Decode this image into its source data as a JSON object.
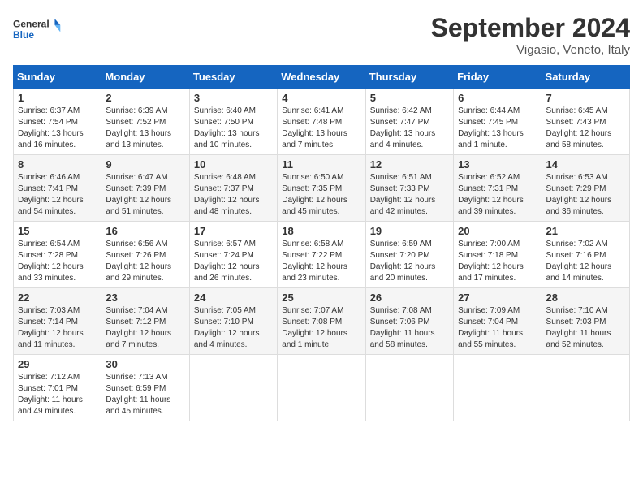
{
  "header": {
    "logo_general": "General",
    "logo_blue": "Blue",
    "month_title": "September 2024",
    "subtitle": "Vigasio, Veneto, Italy"
  },
  "days_of_week": [
    "Sunday",
    "Monday",
    "Tuesday",
    "Wednesday",
    "Thursday",
    "Friday",
    "Saturday"
  ],
  "weeks": [
    [
      {
        "day": "1",
        "sunrise": "6:37 AM",
        "sunset": "7:54 PM",
        "daylight": "13 hours and 16 minutes."
      },
      {
        "day": "2",
        "sunrise": "6:39 AM",
        "sunset": "7:52 PM",
        "daylight": "13 hours and 13 minutes."
      },
      {
        "day": "3",
        "sunrise": "6:40 AM",
        "sunset": "7:50 PM",
        "daylight": "13 hours and 10 minutes."
      },
      {
        "day": "4",
        "sunrise": "6:41 AM",
        "sunset": "7:48 PM",
        "daylight": "13 hours and 7 minutes."
      },
      {
        "day": "5",
        "sunrise": "6:42 AM",
        "sunset": "7:47 PM",
        "daylight": "13 hours and 4 minutes."
      },
      {
        "day": "6",
        "sunrise": "6:44 AM",
        "sunset": "7:45 PM",
        "daylight": "13 hours and 1 minute."
      },
      {
        "day": "7",
        "sunrise": "6:45 AM",
        "sunset": "7:43 PM",
        "daylight": "12 hours and 58 minutes."
      }
    ],
    [
      {
        "day": "8",
        "sunrise": "6:46 AM",
        "sunset": "7:41 PM",
        "daylight": "12 hours and 54 minutes."
      },
      {
        "day": "9",
        "sunrise": "6:47 AM",
        "sunset": "7:39 PM",
        "daylight": "12 hours and 51 minutes."
      },
      {
        "day": "10",
        "sunrise": "6:48 AM",
        "sunset": "7:37 PM",
        "daylight": "12 hours and 48 minutes."
      },
      {
        "day": "11",
        "sunrise": "6:50 AM",
        "sunset": "7:35 PM",
        "daylight": "12 hours and 45 minutes."
      },
      {
        "day": "12",
        "sunrise": "6:51 AM",
        "sunset": "7:33 PM",
        "daylight": "12 hours and 42 minutes."
      },
      {
        "day": "13",
        "sunrise": "6:52 AM",
        "sunset": "7:31 PM",
        "daylight": "12 hours and 39 minutes."
      },
      {
        "day": "14",
        "sunrise": "6:53 AM",
        "sunset": "7:29 PM",
        "daylight": "12 hours and 36 minutes."
      }
    ],
    [
      {
        "day": "15",
        "sunrise": "6:54 AM",
        "sunset": "7:28 PM",
        "daylight": "12 hours and 33 minutes."
      },
      {
        "day": "16",
        "sunrise": "6:56 AM",
        "sunset": "7:26 PM",
        "daylight": "12 hours and 29 minutes."
      },
      {
        "day": "17",
        "sunrise": "6:57 AM",
        "sunset": "7:24 PM",
        "daylight": "12 hours and 26 minutes."
      },
      {
        "day": "18",
        "sunrise": "6:58 AM",
        "sunset": "7:22 PM",
        "daylight": "12 hours and 23 minutes."
      },
      {
        "day": "19",
        "sunrise": "6:59 AM",
        "sunset": "7:20 PM",
        "daylight": "12 hours and 20 minutes."
      },
      {
        "day": "20",
        "sunrise": "7:00 AM",
        "sunset": "7:18 PM",
        "daylight": "12 hours and 17 minutes."
      },
      {
        "day": "21",
        "sunrise": "7:02 AM",
        "sunset": "7:16 PM",
        "daylight": "12 hours and 14 minutes."
      }
    ],
    [
      {
        "day": "22",
        "sunrise": "7:03 AM",
        "sunset": "7:14 PM",
        "daylight": "12 hours and 11 minutes."
      },
      {
        "day": "23",
        "sunrise": "7:04 AM",
        "sunset": "7:12 PM",
        "daylight": "12 hours and 7 minutes."
      },
      {
        "day": "24",
        "sunrise": "7:05 AM",
        "sunset": "7:10 PM",
        "daylight": "12 hours and 4 minutes."
      },
      {
        "day": "25",
        "sunrise": "7:07 AM",
        "sunset": "7:08 PM",
        "daylight": "12 hours and 1 minute."
      },
      {
        "day": "26",
        "sunrise": "7:08 AM",
        "sunset": "7:06 PM",
        "daylight": "11 hours and 58 minutes."
      },
      {
        "day": "27",
        "sunrise": "7:09 AM",
        "sunset": "7:04 PM",
        "daylight": "11 hours and 55 minutes."
      },
      {
        "day": "28",
        "sunrise": "7:10 AM",
        "sunset": "7:03 PM",
        "daylight": "11 hours and 52 minutes."
      }
    ],
    [
      {
        "day": "29",
        "sunrise": "7:12 AM",
        "sunset": "7:01 PM",
        "daylight": "11 hours and 49 minutes."
      },
      {
        "day": "30",
        "sunrise": "7:13 AM",
        "sunset": "6:59 PM",
        "daylight": "11 hours and 45 minutes."
      },
      null,
      null,
      null,
      null,
      null
    ]
  ],
  "labels": {
    "sunrise": "Sunrise:",
    "sunset": "Sunset:",
    "daylight": "Daylight:"
  }
}
